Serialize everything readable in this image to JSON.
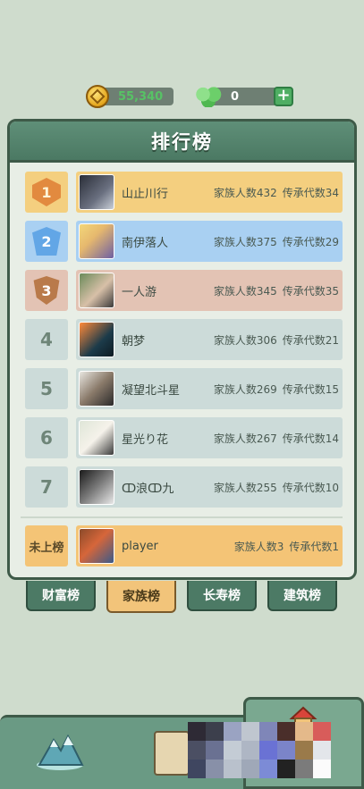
{
  "currency": {
    "coins": "55,340",
    "gems": "0",
    "add_label": "+"
  },
  "panel": {
    "title": "排行榜"
  },
  "ranking": [
    {
      "rank": "1",
      "name": "山止川行",
      "family": "家族人数432",
      "generations": "传承代数34",
      "color": "#f4cf7f",
      "badge": "b1"
    },
    {
      "rank": "2",
      "name": "南伊落人",
      "family": "家族人数375",
      "generations": "传承代数29",
      "color": "#a9d0f2",
      "badge": "b2"
    },
    {
      "rank": "3",
      "name": "一人游",
      "family": "家族人数345",
      "generations": "传承代数35",
      "color": "#e3c3b4",
      "badge": "b3"
    },
    {
      "rank": "4",
      "name": "朝梦",
      "family": "家族人数306",
      "generations": "传承代数21",
      "color": "#ccdbd9"
    },
    {
      "rank": "5",
      "name": "凝望北斗星",
      "family": "家族人数269",
      "generations": "传承代数15",
      "color": "#ccdbd9"
    },
    {
      "rank": "6",
      "name": "星光り花",
      "family": "家族人数267",
      "generations": "传承代数14",
      "color": "#ccdbd9"
    },
    {
      "rank": "7",
      "name": "ↀ浪ↀ九",
      "family": "家族人数255",
      "generations": "传承代数10",
      "color": "#ccdbd9"
    }
  ],
  "player": {
    "rank": "未上榜",
    "name": "player",
    "family": "家族人数3",
    "generations": "传承代数1"
  },
  "tabs": [
    {
      "label": "财富榜",
      "active": false
    },
    {
      "label": "家族榜",
      "active": true
    },
    {
      "label": "长寿榜",
      "active": false
    },
    {
      "label": "建筑榜",
      "active": false
    }
  ],
  "icons": {
    "coin": "coin-icon",
    "gem": "gem-icon",
    "mountain": "mountain-icon",
    "book": "book-icon",
    "tower": "tower-icon"
  }
}
